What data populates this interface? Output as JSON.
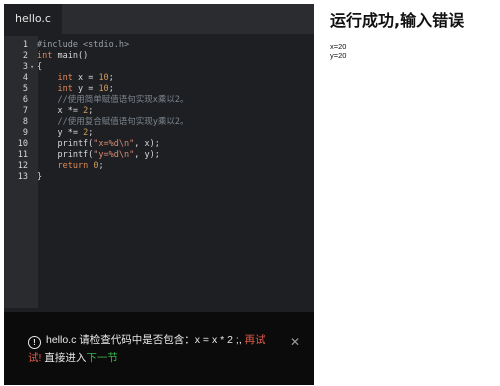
{
  "editor": {
    "tab_label": "hello.c",
    "lines": [
      {
        "num": "1",
        "fold": "",
        "tokens": [
          {
            "c": "t-pp",
            "t": "#include <stdio.h>"
          }
        ]
      },
      {
        "num": "2",
        "fold": "",
        "tokens": [
          {
            "c": "t-kw",
            "t": "int"
          },
          {
            "c": "t-tx",
            "t": " main()"
          }
        ]
      },
      {
        "num": "3",
        "fold": "▾",
        "tokens": [
          {
            "c": "t-tx",
            "t": "{"
          }
        ]
      },
      {
        "num": "4",
        "fold": "",
        "tokens": [
          {
            "c": "t-tx",
            "t": "    "
          },
          {
            "c": "t-kw",
            "t": "int"
          },
          {
            "c": "t-tx",
            "t": " x = "
          },
          {
            "c": "t-num",
            "t": "10"
          },
          {
            "c": "t-tx",
            "t": ";"
          }
        ]
      },
      {
        "num": "5",
        "fold": "",
        "tokens": [
          {
            "c": "t-tx",
            "t": "    "
          },
          {
            "c": "t-kw",
            "t": "int"
          },
          {
            "c": "t-tx",
            "t": " y = "
          },
          {
            "c": "t-num",
            "t": "10"
          },
          {
            "c": "t-tx",
            "t": ";"
          }
        ]
      },
      {
        "num": "6",
        "fold": "",
        "tokens": [
          {
            "c": "t-cm",
            "t": "    //使用简单赋值语句实现x乘以2。"
          }
        ]
      },
      {
        "num": "7",
        "fold": "",
        "tokens": [
          {
            "c": "t-tx",
            "t": "    x *= "
          },
          {
            "c": "t-num",
            "t": "2"
          },
          {
            "c": "t-tx",
            "t": ";"
          }
        ]
      },
      {
        "num": "8",
        "fold": "",
        "tokens": [
          {
            "c": "t-cm",
            "t": "    //使用复合赋值语句实现y乘以2。"
          }
        ]
      },
      {
        "num": "9",
        "fold": "",
        "tokens": [
          {
            "c": "t-tx",
            "t": "    y *= "
          },
          {
            "c": "t-num",
            "t": "2"
          },
          {
            "c": "t-tx",
            "t": ";"
          }
        ]
      },
      {
        "num": "10",
        "fold": "",
        "tokens": [
          {
            "c": "t-tx",
            "t": "    printf("
          },
          {
            "c": "t-str",
            "t": "\"x=%d\\n\""
          },
          {
            "c": "t-tx",
            "t": ", x);"
          }
        ]
      },
      {
        "num": "11",
        "fold": "",
        "tokens": [
          {
            "c": "t-tx",
            "t": "    printf("
          },
          {
            "c": "t-str",
            "t": "\"y=%d\\n\""
          },
          {
            "c": "t-tx",
            "t": ", y);"
          }
        ]
      },
      {
        "num": "12",
        "fold": "",
        "tokens": [
          {
            "c": "t-tx",
            "t": "    "
          },
          {
            "c": "t-kw",
            "t": "return"
          },
          {
            "c": "t-tx",
            "t": " "
          },
          {
            "c": "t-num",
            "t": "0"
          },
          {
            "c": "t-tx",
            "t": ";"
          }
        ]
      },
      {
        "num": "13",
        "fold": "",
        "tokens": [
          {
            "c": "t-tx",
            "t": "}"
          }
        ]
      }
    ]
  },
  "notice": {
    "icon": "!",
    "message": "hello.c 请检查代码中是否包含：x = x * 2 ;, ",
    "retry": "再试",
    "retry_tail": "试! ",
    "enter": "直接进入",
    "next": "下一节",
    "close": "✕"
  },
  "result": {
    "title": "运行成功,输入错误",
    "output": [
      "x=20",
      "y=20"
    ]
  },
  "colors": {
    "editor_bg": "#1e1f22",
    "retry": "#e05a48",
    "next": "#38b44a"
  }
}
